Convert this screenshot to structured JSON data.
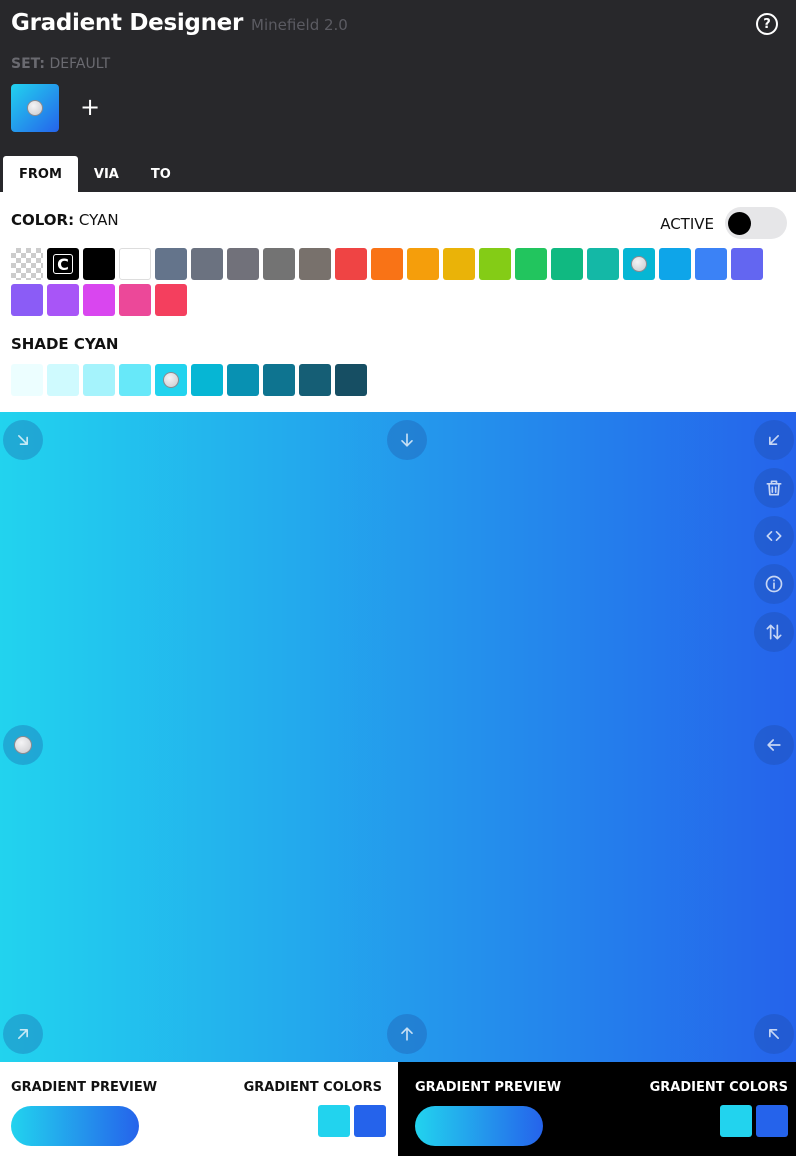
{
  "header": {
    "title": "Gradient Designer",
    "subtitle": "Minefield 2.0",
    "help_glyph": "?",
    "set_key": "SET:",
    "set_value": "DEFAULT",
    "add_glyph": "+"
  },
  "tabs": [
    {
      "label": "FROM",
      "active": true
    },
    {
      "label": "VIA",
      "active": false
    },
    {
      "label": "TO",
      "active": false
    }
  ],
  "color": {
    "key": "COLOR:",
    "value": "CYAN",
    "active_label": "ACTIVE",
    "active_on": true
  },
  "palette": [
    {
      "name": "transparent",
      "hex": "transparent"
    },
    {
      "name": "current",
      "hex": "#000000",
      "text": "C"
    },
    {
      "name": "black",
      "hex": "#000000"
    },
    {
      "name": "white",
      "hex": "#ffffff"
    },
    {
      "name": "slate",
      "hex": "#64748b"
    },
    {
      "name": "gray",
      "hex": "#6b7280"
    },
    {
      "name": "zinc",
      "hex": "#71717a"
    },
    {
      "name": "neutral",
      "hex": "#737373"
    },
    {
      "name": "stone",
      "hex": "#78716c"
    },
    {
      "name": "red",
      "hex": "#ef4444"
    },
    {
      "name": "orange",
      "hex": "#f97316"
    },
    {
      "name": "amber",
      "hex": "#f59e0b"
    },
    {
      "name": "yellow",
      "hex": "#eab308"
    },
    {
      "name": "lime",
      "hex": "#84cc16"
    },
    {
      "name": "green",
      "hex": "#22c55e"
    },
    {
      "name": "emerald",
      "hex": "#10b981"
    },
    {
      "name": "teal",
      "hex": "#14b8a6"
    },
    {
      "name": "cyan",
      "hex": "#06b6d4",
      "selected": true
    },
    {
      "name": "sky",
      "hex": "#0ea5e9"
    },
    {
      "name": "blue",
      "hex": "#3b82f6"
    },
    {
      "name": "indigo",
      "hex": "#6366f1"
    },
    {
      "name": "violet",
      "hex": "#8b5cf6"
    },
    {
      "name": "purple",
      "hex": "#a855f7"
    },
    {
      "name": "fuchsia",
      "hex": "#d946ef"
    },
    {
      "name": "pink",
      "hex": "#ec4899"
    },
    {
      "name": "rose",
      "hex": "#f43f5e"
    }
  ],
  "shade": {
    "label": "SHADE CYAN",
    "shades": [
      {
        "hex": "#ecfeff"
      },
      {
        "hex": "#cffafe"
      },
      {
        "hex": "#a5f3fc"
      },
      {
        "hex": "#67e8f9"
      },
      {
        "hex": "#22d3ee",
        "selected": true
      },
      {
        "hex": "#06b6d4"
      },
      {
        "hex": "#0891b2"
      },
      {
        "hex": "#0e7490"
      },
      {
        "hex": "#155e75"
      },
      {
        "hex": "#164e63"
      }
    ]
  },
  "gradient": {
    "from": "#22d3ee",
    "to": "#2563eb"
  },
  "controls": [
    {
      "name": "direction-bottom-right-icon",
      "icon": "arrow-down-right"
    },
    {
      "name": "direction-bottom-icon",
      "icon": "arrow-down"
    },
    {
      "name": "direction-bottom-left-icon",
      "icon": "arrow-down-left"
    },
    {
      "name": "delete-icon",
      "icon": "trash"
    },
    {
      "name": "code-icon",
      "icon": "code"
    },
    {
      "name": "info-icon",
      "icon": "info"
    },
    {
      "name": "swap-icon",
      "icon": "arrows-up-down"
    },
    {
      "name": "direction-right-icon",
      "icon": "selected-dot"
    },
    {
      "name": "direction-left-icon",
      "icon": "arrow-left"
    },
    {
      "name": "direction-top-right-icon",
      "icon": "arrow-up-right"
    },
    {
      "name": "direction-top-icon",
      "icon": "arrow-up"
    },
    {
      "name": "direction-top-left-icon",
      "icon": "arrow-up-left"
    }
  ],
  "footer": {
    "light": {
      "preview_label": "GRADIENT PREVIEW",
      "colors_label": "GRADIENT COLORS"
    },
    "dark": {
      "preview_label": "GRADIENT PREVIEW",
      "colors_label": "GRADIENT COLORS"
    },
    "chips": [
      "#22d3ee",
      "#2563eb"
    ]
  }
}
